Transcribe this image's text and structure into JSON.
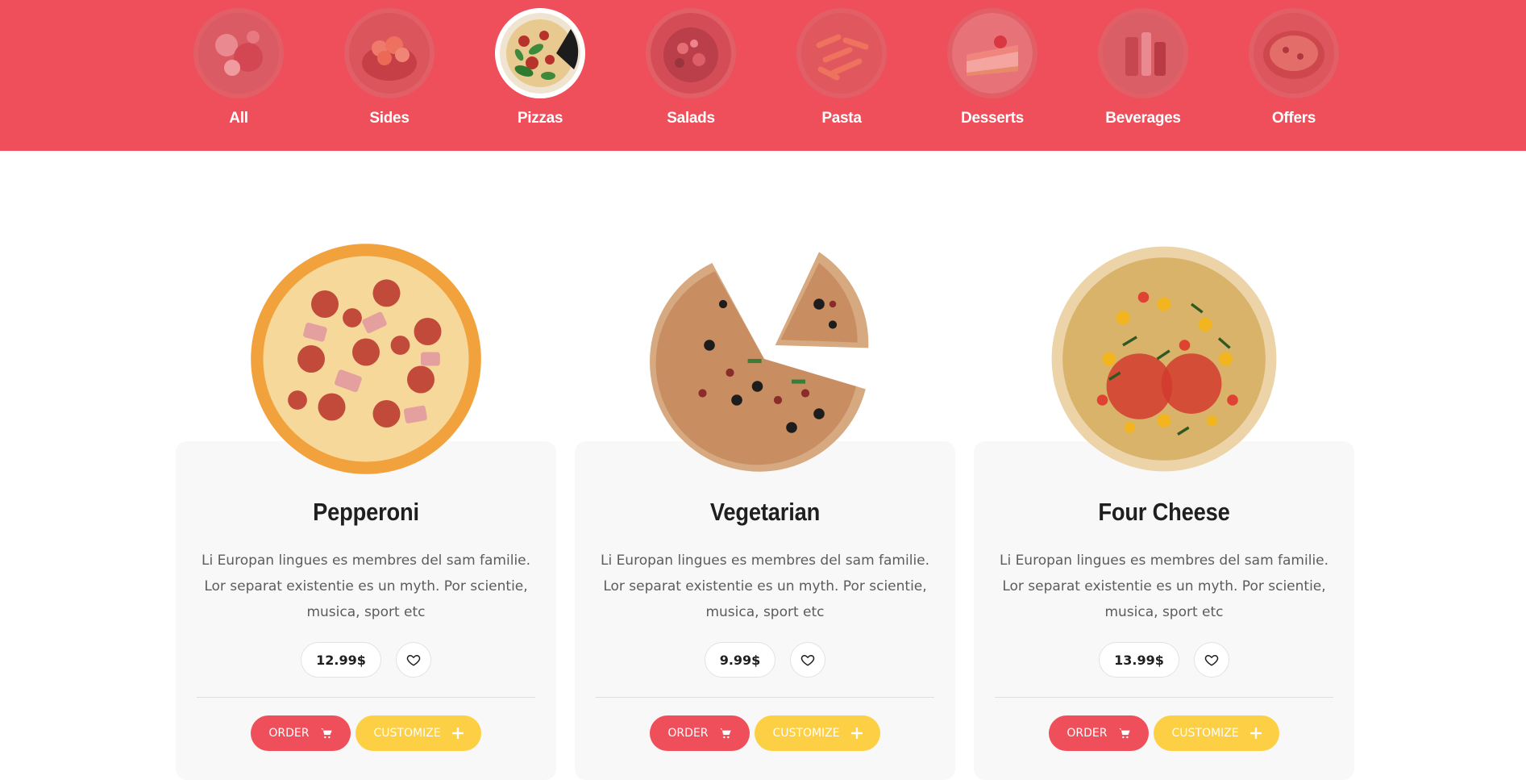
{
  "categories": [
    {
      "label": "All",
      "icon": "food-platter-icon",
      "active": false
    },
    {
      "label": "Sides",
      "icon": "chicken-wings-icon",
      "active": false
    },
    {
      "label": "Pizzas",
      "icon": "pizza-icon",
      "active": true
    },
    {
      "label": "Salads",
      "icon": "salad-icon",
      "active": false
    },
    {
      "label": "Pasta",
      "icon": "pasta-icon",
      "active": false
    },
    {
      "label": "Desserts",
      "icon": "cheesecake-icon",
      "active": false
    },
    {
      "label": "Beverages",
      "icon": "drinks-icon",
      "active": false
    },
    {
      "label": "Offers",
      "icon": "offer-pizza-icon",
      "active": false
    }
  ],
  "products": [
    {
      "name": "Pepperoni",
      "description": "Li Europan lingues es membres del sam familie. Lor separat existentie es un myth. Por scientie, musica, sport etc",
      "price": "12.99$",
      "order_label": "ORDER",
      "customize_label": "CUSTOMIZE",
      "image": "pepperoni-pizza"
    },
    {
      "name": "Vegetarian",
      "description": "Li Europan lingues es membres del sam familie. Lor separat existentie es un myth. Por scientie, musica, sport etc",
      "price": "9.99$",
      "order_label": "ORDER",
      "customize_label": "CUSTOMIZE",
      "image": "vegetarian-pizza"
    },
    {
      "name": "Four Cheese",
      "description": "Li Europan lingues es membres del sam familie. Lor separat existentie es un myth. Por scientie, musica, sport etc",
      "price": "13.99$",
      "order_label": "ORDER",
      "customize_label": "CUSTOMIZE",
      "image": "four-cheese-pizza"
    }
  ],
  "colors": {
    "primary": "#ee4f5a",
    "accent": "#fccf44",
    "card_bg": "#f8f8f8",
    "text_dark": "#1f1f1f",
    "text_muted": "#5c5c5c"
  }
}
